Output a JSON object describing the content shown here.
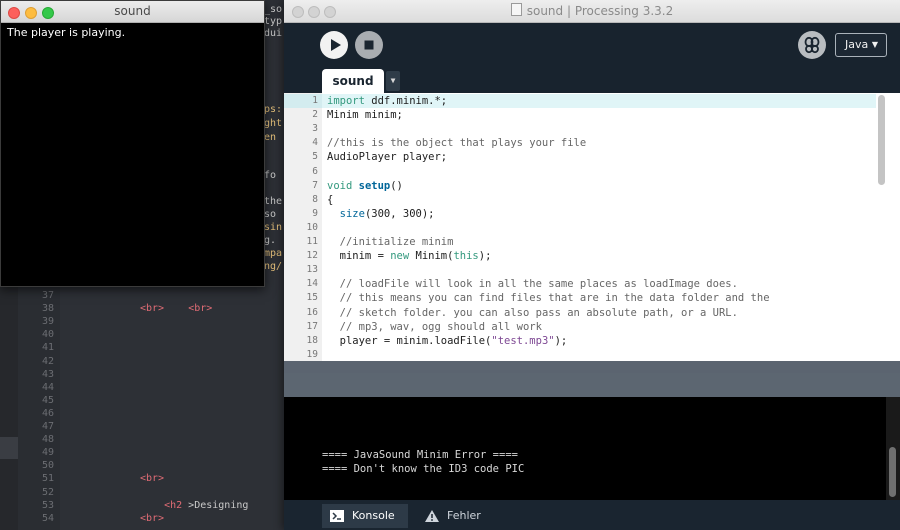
{
  "background_editor": {
    "lines": [
      {
        "num": "37",
        "code": ""
      },
      {
        "num": "38",
        "code_html": "<span class=\"tag\">&lt;br&gt;</span>    <span class=\"tag\">&lt;br&gt;</span>"
      },
      {
        "num": "39",
        "code": ""
      },
      {
        "num": "40",
        "code": ""
      },
      {
        "num": "41",
        "code": ""
      },
      {
        "num": "42",
        "code": ""
      },
      {
        "num": "43",
        "code": ""
      },
      {
        "num": "44",
        "code": ""
      },
      {
        "num": "45",
        "code": ""
      },
      {
        "num": "46",
        "code": ""
      },
      {
        "num": "47",
        "code": ""
      },
      {
        "num": "48",
        "code": ""
      },
      {
        "num": "49",
        "code": ""
      },
      {
        "num": "50",
        "code": ""
      },
      {
        "num": "51",
        "code_html": "<span class=\"tag\">&lt;br&gt;</span>"
      },
      {
        "num": "52",
        "code": ""
      },
      {
        "num": "53",
        "code_html": "    <span class=\"tag\">&lt;h2</span> &gt;Designing"
      },
      {
        "num": "54",
        "code_html": "<span class=\"tag\">&lt;br&gt;</span>"
      }
    ]
  },
  "processing_window": {
    "title": "sound | Processing 3.3.2",
    "mode": "Java",
    "tab": "sound",
    "code_lines": [
      {
        "num": "1",
        "html": "<span class=\"kw\">import</span> ddf.minim.*;"
      },
      {
        "num": "2",
        "html": "Minim minim;"
      },
      {
        "num": "3",
        "html": ""
      },
      {
        "num": "4",
        "html": "<span class=\"cm\">//this is the object that plays your file</span>"
      },
      {
        "num": "5",
        "html": "AudioPlayer player;"
      },
      {
        "num": "6",
        "html": ""
      },
      {
        "num": "7",
        "html": "<span class=\"kw\">void</span> <span class=\"fn\">setup</span>()"
      },
      {
        "num": "8",
        "html": "{"
      },
      {
        "num": "9",
        "html": "  <span class=\"bi\">size</span>(300, 300);"
      },
      {
        "num": "10",
        "html": ""
      },
      {
        "num": "11",
        "html": "  <span class=\"cm\">//initialize minim</span>"
      },
      {
        "num": "12",
        "html": "  minim = <span class=\"kw\">new</span> Minim(<span class=\"kw\">this</span>);"
      },
      {
        "num": "13",
        "html": ""
      },
      {
        "num": "14",
        "html": "  <span class=\"cm\">// loadFile will look in all the same places as loadImage does.</span>"
      },
      {
        "num": "15",
        "html": "  <span class=\"cm\">// this means you can find files that are in the data folder and the</span>"
      },
      {
        "num": "16",
        "html": "  <span class=\"cm\">// sketch folder. you can also pass an absolute path, or a URL.</span>"
      },
      {
        "num": "17",
        "html": "  <span class=\"cm\">// mp3, wav, ogg should all work</span>"
      },
      {
        "num": "18",
        "html": "  player = minim.loadFile(<span class=\"st\">\"test.mp3\"</span>);"
      },
      {
        "num": "19",
        "html": ""
      }
    ],
    "console_lines": [
      "==== JavaSound Minim Error ====",
      "==== Don't know the ID3 code PIC"
    ],
    "footer_tabs": {
      "console": "Konsole",
      "errors": "Fehler"
    }
  },
  "sketch_window": {
    "title": "sound",
    "status": "The player is playing."
  },
  "colors": {
    "processing_dark": "#1a2530",
    "console_bg": "#000000",
    "keyword_green": "#33997e",
    "function_blue": "#006699",
    "string_purple": "#7d4793"
  }
}
